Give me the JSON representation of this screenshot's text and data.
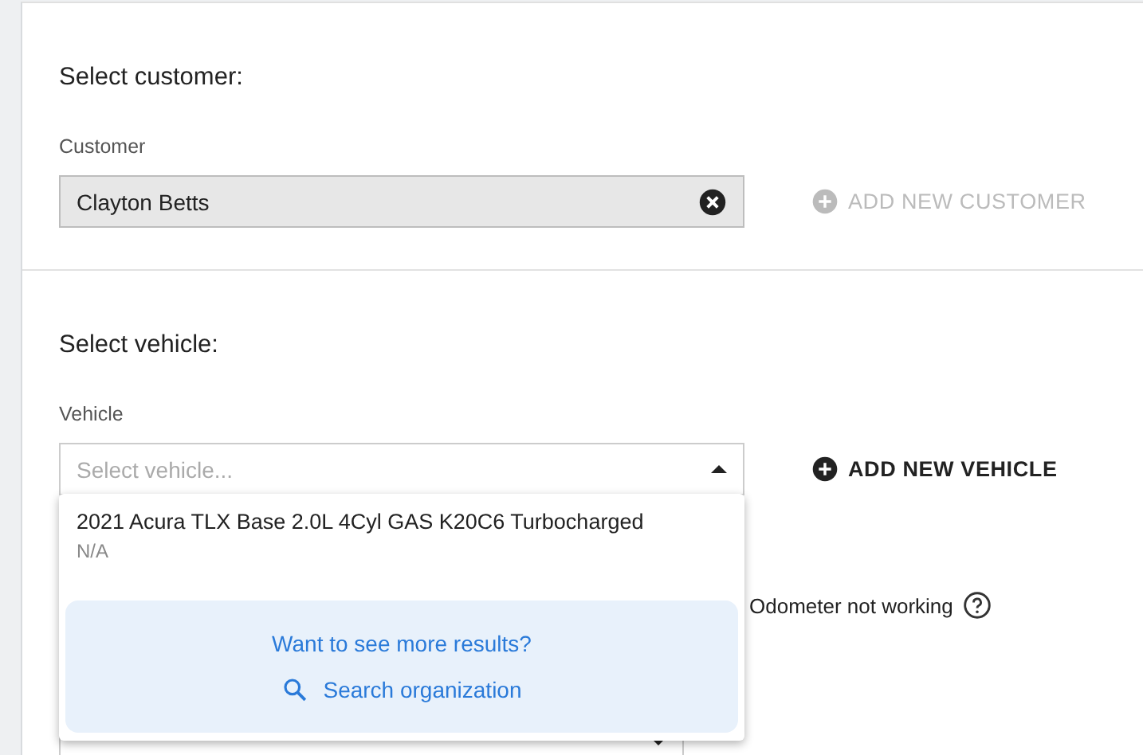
{
  "customer_section": {
    "title": "Select customer:",
    "field_label": "Customer",
    "value": "Clayton Betts",
    "add_button": {
      "label": "ADD NEW CUSTOMER",
      "disabled": true
    }
  },
  "vehicle_section": {
    "title": "Select vehicle:",
    "field_label": "Vehicle",
    "placeholder": "Select vehicle...",
    "expanded": true,
    "add_button": {
      "label": "ADD NEW VEHICLE",
      "disabled": false
    },
    "dropdown": {
      "options": [
        {
          "title": "2021 Acura TLX Base 2.0L 4Cyl GAS K20C6 Turbocharged",
          "subtitle": "N/A"
        }
      ],
      "more_prompt": "Want to see more results?",
      "search_link": "Search organization"
    },
    "odometer_label": "Odometer not working"
  }
}
